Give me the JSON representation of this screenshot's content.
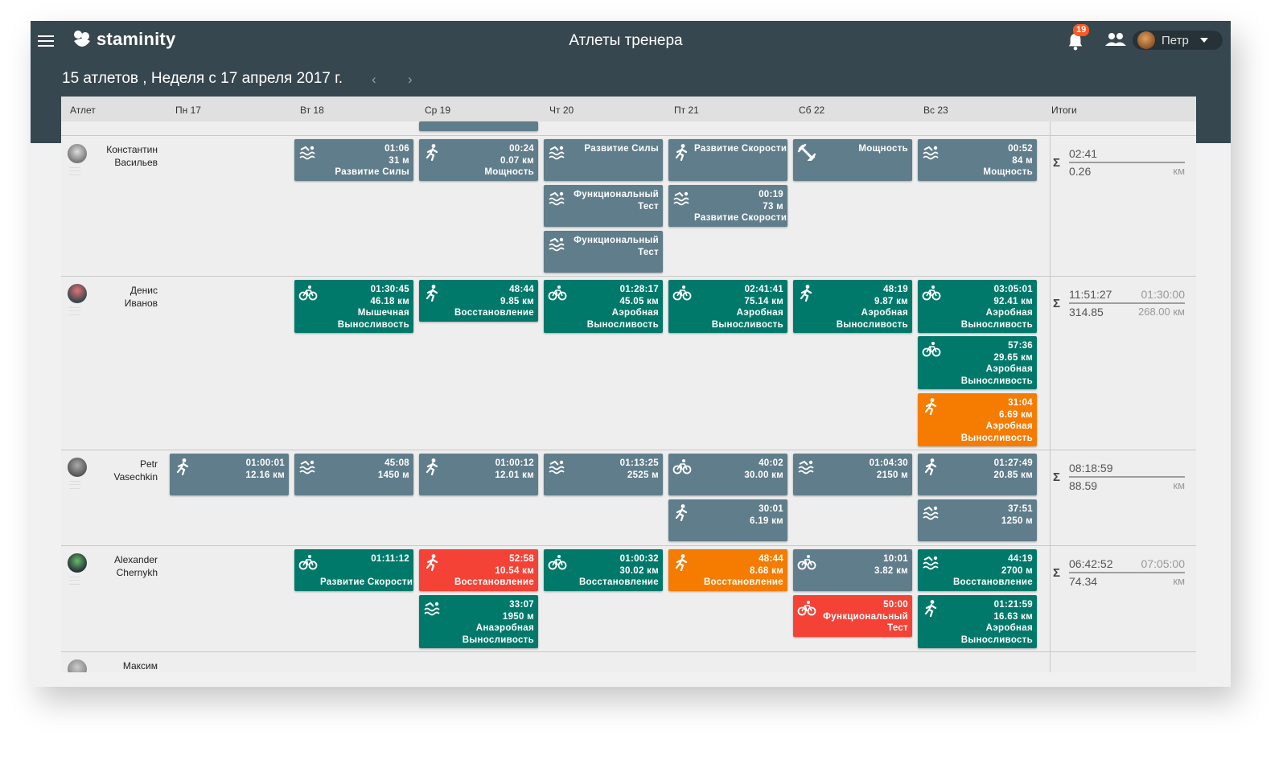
{
  "header": {
    "logo_text": "staminity",
    "page_title": "Атлеты тренера",
    "notification_count": "19",
    "user_name": "Петр",
    "week_title": "15 атлетов , Неделя с 17 апреля 2017 г.",
    "prev": "‹",
    "next": "›"
  },
  "columns": [
    "Атлет",
    "Пн 17",
    "Вт 18",
    "Ср 19",
    "Чт 20",
    "Пт 21",
    "Сб 22",
    "Вс 23",
    "Итоги"
  ],
  "colors": {
    "gray": "#607d8b",
    "green": "#00796b",
    "red": "#f44336",
    "orange": "#f57c00",
    "header": "#37474f"
  },
  "athletes": [
    {
      "name1": "Константин",
      "name2": "Васильев",
      "sum": {
        "time": "02:41",
        "plan_time": "",
        "dist": "0.26",
        "plan_dist": "",
        "unit": "км",
        "sigma": "Σ"
      },
      "cards": [
        {
          "lines": [
            "01:06",
            "31  м",
            "Развитие Силы"
          ],
          "icon": "swim-icon"
        },
        {
          "lines": [
            "00:24",
            "0.07  км",
            "Мощность"
          ],
          "icon": "run-icon"
        },
        {
          "lines": [
            "Развитие Силы"
          ],
          "icon": "swim-icon"
        },
        {
          "lines": [
            "Функциональный",
            "Тест"
          ],
          "icon": "swim-icon"
        },
        {
          "lines": [
            "Функциональный",
            "Тест"
          ],
          "icon": "swim-icon"
        },
        {
          "lines": [
            "Развитие Скорости"
          ],
          "icon": "run-icon"
        },
        {
          "lines": [
            "00:19",
            "73  м",
            "Развитие Скорости"
          ],
          "icon": "swim-icon"
        },
        {
          "lines": [
            "Мощность"
          ],
          "icon": "strength-icon"
        },
        {
          "lines": [
            "00:52",
            "84  м",
            "Мощность"
          ],
          "icon": "swim-icon"
        }
      ]
    },
    {
      "name1": "Денис",
      "name2": "Иванов",
      "sum": {
        "time": "11:51:27",
        "plan_time": "01:30:00",
        "dist": "314.85",
        "plan_dist": "268.00 км",
        "unit": "",
        "sigma": "Σ"
      },
      "cards": [
        {
          "lines": [
            "01:30:45",
            "46.18  км",
            "Мышечная",
            "Выносливость"
          ],
          "icon": "bike-icon"
        },
        {
          "lines": [
            "48:44",
            "9.85  км",
            "Восстановление"
          ],
          "icon": "run-icon"
        },
        {
          "lines": [
            "01:28:17",
            "45.05  км",
            "Аэробная",
            "Выносливость"
          ],
          "icon": "bike-icon"
        },
        {
          "lines": [
            "02:41:41",
            "75.14  км",
            "Аэробная",
            "Выносливость"
          ],
          "icon": "bike-icon"
        },
        {
          "lines": [
            "48:19",
            "9.87  км",
            "Аэробная",
            "Выносливость"
          ],
          "icon": "run-icon"
        },
        {
          "lines": [
            "03:05:01",
            "92.41  км",
            "Аэробная",
            "Выносливость"
          ],
          "icon": "bike-icon"
        },
        {
          "lines": [
            "57:36",
            "29.65  км",
            "Аэробная",
            "Выносливость"
          ],
          "icon": "bike-icon"
        },
        {
          "lines": [
            "31:04",
            "6.69  км",
            "Аэробная",
            "Выносливость"
          ],
          "icon": "run-icon"
        }
      ]
    },
    {
      "name1": "Petr",
      "name2": "Vasechkin",
      "sum": {
        "time": "08:18:59",
        "plan_time": "",
        "dist": "88.59",
        "plan_dist": "",
        "unit": "км",
        "sigma": "Σ"
      },
      "cards": [
        {
          "lines": [
            "01:00:01",
            "12.16  км"
          ],
          "icon": "run-icon"
        },
        {
          "lines": [
            "45:08",
            "1450  м"
          ],
          "icon": "swim-icon"
        },
        {
          "lines": [
            "01:00:12",
            "12.01  км"
          ],
          "icon": "run-icon"
        },
        {
          "lines": [
            "01:13:25",
            "2525  м"
          ],
          "icon": "swim-icon"
        },
        {
          "lines": [
            "40:02",
            "30.00  км"
          ],
          "icon": "bike-icon"
        },
        {
          "lines": [
            "30:01",
            "6.19  км"
          ],
          "icon": "run-icon"
        },
        {
          "lines": [
            "01:04:30",
            "2150  м"
          ],
          "icon": "swim-icon"
        },
        {
          "lines": [
            "01:27:49",
            "20.85  км"
          ],
          "icon": "run-icon"
        },
        {
          "lines": [
            "37:51",
            "1250  м"
          ],
          "icon": "swim-icon"
        }
      ]
    },
    {
      "name1": "Alexander",
      "name2": "Chernykh",
      "sum": {
        "time": "06:42:52",
        "plan_time": "07:05:00",
        "dist": "74.34",
        "plan_dist": "",
        "unit": "км",
        "sigma": "Σ"
      },
      "cards": [
        {
          "lines": [
            "01:11:12",
            "",
            "Развитие Скорости"
          ],
          "icon": "bike-icon"
        },
        {
          "lines": [
            "52:58",
            "10.54  км",
            "Восстановление"
          ],
          "icon": "run-icon"
        },
        {
          "lines": [
            "33:07",
            "1950  м",
            "Анаэробная",
            "Выносливость"
          ],
          "icon": "swim-icon"
        },
        {
          "lines": [
            "01:00:32",
            "30.02  км",
            "Восстановление"
          ],
          "icon": "bike-icon"
        },
        {
          "lines": [
            "48:44",
            "8.68  км",
            "Восстановление"
          ],
          "icon": "run-icon"
        },
        {
          "lines": [
            "10:01",
            "3.82  км"
          ],
          "icon": "bike-icon"
        },
        {
          "lines": [
            "50:00",
            "Функциональный",
            "Тест"
          ],
          "icon": "bike-icon"
        },
        {
          "lines": [
            "44:19",
            "2700  м",
            "Восстановление"
          ],
          "icon": "swim-icon"
        },
        {
          "lines": [
            "01:21:59",
            "16.63  км",
            "Аэробная",
            "Выносливость"
          ],
          "icon": "run-icon"
        }
      ]
    },
    {
      "name1": "Максим",
      "name2": ""
    }
  ]
}
